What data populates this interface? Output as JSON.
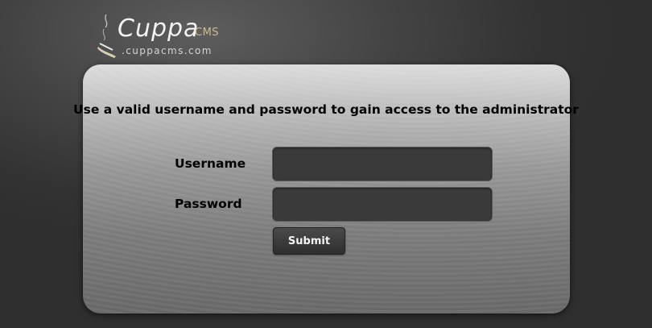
{
  "logo": {
    "name": "Cuppa",
    "suffix": "CMS",
    "url": ".cuppacms.com",
    "icon": "coffee-cup-icon"
  },
  "login": {
    "instructions": "Use a valid username and password to gain access to the administrator",
    "username_label": "Username",
    "username_value": "",
    "password_label": "Password",
    "password_value": "",
    "submit_label": "Submit"
  },
  "colors": {
    "background": "#3a3a3a",
    "panel_top": "#dcdcdc",
    "panel_bottom": "#676767",
    "field_bg": "#3a3a3a",
    "logo_accent": "#cdbb8a"
  }
}
